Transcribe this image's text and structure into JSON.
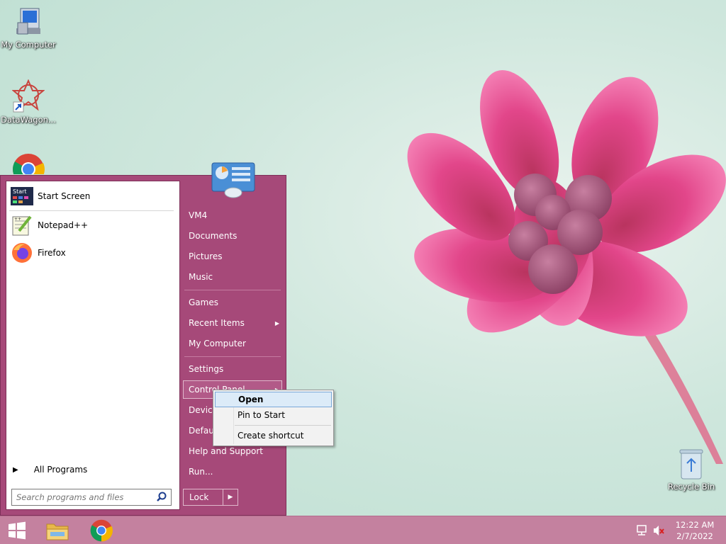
{
  "desktop": {
    "icons": [
      {
        "label": "My Computer",
        "icon": "computer-icon"
      },
      {
        "label": "DataWagon...",
        "icon": "datawagon-icon"
      },
      {
        "label": "Recycle Bin",
        "icon": "recycle-bin-icon"
      }
    ]
  },
  "start_menu": {
    "pinned": [
      {
        "label": "Start Screen",
        "icon": "start-screen-icon"
      },
      {
        "label": "Notepad++",
        "icon": "notepadpp-icon"
      },
      {
        "label": "Firefox",
        "icon": "firefox-icon"
      }
    ],
    "all_programs": "All Programs",
    "search_placeholder": "Search programs and files",
    "right_items": [
      {
        "label": "VM4"
      },
      {
        "label": "Documents"
      },
      {
        "label": "Pictures"
      },
      {
        "label": "Music"
      },
      {
        "label": "Games"
      },
      {
        "label": "Recent Items",
        "has_arrow": true
      },
      {
        "label": "My Computer"
      },
      {
        "label": "Settings"
      },
      {
        "label": "Control Panel",
        "has_arrow": true
      },
      {
        "label": "Devices"
      },
      {
        "label": "Default"
      },
      {
        "label": "Help and Support"
      },
      {
        "label": "Run..."
      }
    ],
    "lock_label": "Lock"
  },
  "context_menu": {
    "items": [
      {
        "label": "Open",
        "bold": true,
        "highlighted": true
      },
      {
        "label": "Pin to Start"
      },
      {
        "label": "Create shortcut"
      }
    ]
  },
  "taskbar": {
    "time": "12:22 AM",
    "date": "2/7/2022"
  },
  "colors": {
    "start_menu_bg": "#a64979",
    "taskbar_bg": "#c4819f",
    "highlight": "#dcebf8"
  }
}
